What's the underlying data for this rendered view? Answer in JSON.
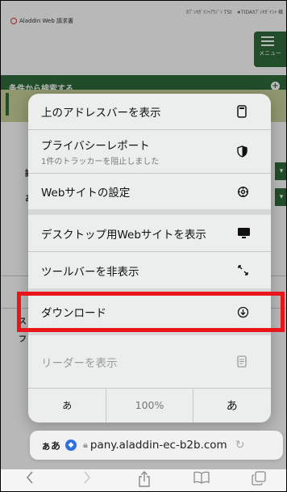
{
  "site": {
    "logo_text": "Aladdin Web 請求書",
    "header_links": "ｶﾌﾞｼｷｶﾞｲｼｬｱﾗｼﾞﾝ TSt　★TIDAｶﾌﾞｼｷｶﾞｲｼｬ 様",
    "menu_label": "メニュー",
    "search_bar_label": "条件から検索する",
    "search_plus": "+",
    "side_chars": [
      "請",
      "あ",
      "ス",
      "フ"
    ]
  },
  "menu": {
    "items": [
      {
        "label": "上のアドレスバーを表示",
        "icon": "phone-top-icon"
      },
      {
        "label": "プライバシーレポート",
        "sublabel": "1件のトラッカーを阻止しました",
        "icon": "shield-half-icon"
      },
      {
        "label": "Webサイトの設定",
        "icon": "gear-icon"
      },
      {
        "label": "デスクトップ用Webサイトを表示",
        "icon": "desktop-icon"
      },
      {
        "label": "ツールバーを非表示",
        "icon": "arrows-diagonal-icon"
      },
      {
        "label": "ダウンロード",
        "icon": "download-circle-icon"
      },
      {
        "label": "リーダーを表示",
        "icon": "reader-icon"
      }
    ],
    "font_small": "あ",
    "zoom": "100%",
    "font_large": "あ"
  },
  "address_bar": {
    "aa_label": "ぁあ",
    "url": "pany.aladdin-ec-b2b.com"
  },
  "colors": {
    "brand_green": "#2f6b3b",
    "olive": "#c9d29a",
    "highlight_red": "#e8151b",
    "shield_blue": "#2f6fe0"
  }
}
